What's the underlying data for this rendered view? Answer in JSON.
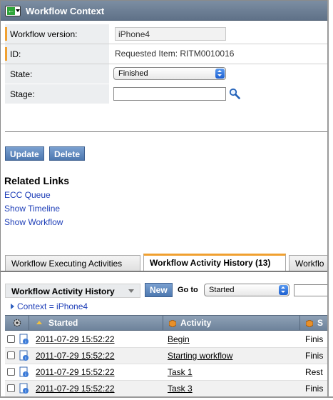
{
  "window": {
    "title": "Workflow Context"
  },
  "form": {
    "workflow_version": {
      "label": "Workflow version:",
      "value": "iPhone4"
    },
    "id": {
      "label": "ID:",
      "value": "Requested Item: RITM0010016"
    },
    "state": {
      "label": "State:",
      "value": "Finished"
    },
    "stage": {
      "label": "Stage:",
      "value": ""
    }
  },
  "actions": {
    "update": "Update",
    "delete": "Delete"
  },
  "related_links": {
    "heading": "Related Links",
    "links": [
      "ECC Queue",
      "Show Timeline",
      "Show Workflow"
    ]
  },
  "tabs": [
    {
      "label": "Workflow Executing Activities",
      "active": false
    },
    {
      "label": "Workflow Activity History (13)",
      "active": true
    },
    {
      "label": "Workflo",
      "active": false
    }
  ],
  "list": {
    "title": "Workflow Activity History",
    "new_label": "New",
    "goto_label": "Go to",
    "goto_value": "Started",
    "breadcrumb": "Context = iPhone4",
    "columns": [
      "Started",
      "Activity",
      "S"
    ],
    "rows": [
      {
        "started": "2011-07-29 15:52:22",
        "activity": "Begin",
        "state": "Finis"
      },
      {
        "started": "2011-07-29 15:52:22",
        "activity": "Starting workflow",
        "state": "Finis"
      },
      {
        "started": "2011-07-29 15:52:22",
        "activity": "Task 1",
        "state": "Rest"
      },
      {
        "started": "2011-07-29 15:52:22",
        "activity": "Task 3",
        "state": "Finis"
      }
    ]
  },
  "colors": {
    "accent": "#f0a030",
    "title_bar": "#6a7c92",
    "link": "#1f3fb8",
    "button": "#5a84bc"
  },
  "icons": {
    "back": "green-back-arrow-icon",
    "search": "magnifier-icon",
    "personalize": "gear-icon",
    "record": "document-icon",
    "activity": "orange-cube-icon"
  }
}
